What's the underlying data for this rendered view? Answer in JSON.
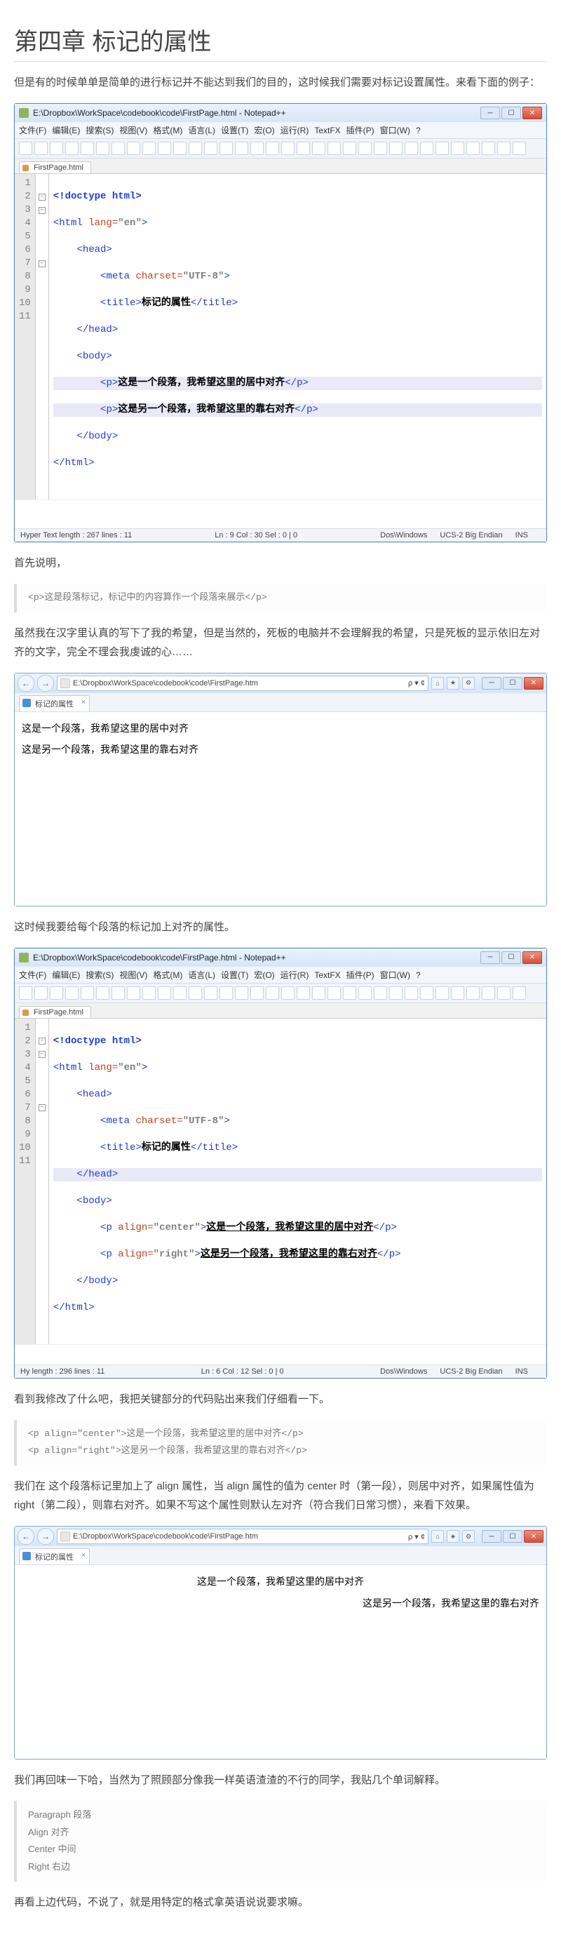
{
  "title": "第四章 标记的属性",
  "intro": "但是有的时候单单是简单的进行标记并不能达到我们的目的，这时候我们需要对标记设置属性。来看下面的例子：",
  "npp1": {
    "title": "E:\\Dropbox\\WorkSpace\\codebook\\code\\FirstPage.html - Notepad++",
    "tab": "FirstPage.html",
    "menus": [
      "文件(F)",
      "编辑(E)",
      "搜索(S)",
      "视图(V)",
      "格式(M)",
      "语言(L)",
      "设置(T)",
      "宏(O)",
      "运行(R)",
      "TextFX",
      "插件(P)",
      "窗口(W)",
      "?"
    ],
    "status": {
      "left": "Hyper Text length : 267     lines : 11",
      "pos": "Ln : 9    Col : 30    Sel : 0 | 0",
      "eol": "Dos\\Windows",
      "enc": "UCS-2 Big Endian",
      "mode": "INS"
    }
  },
  "code1": {
    "l1_a": "<!doctype html>",
    "l2_a": "<",
    "l2_b": "html",
    "l2_c": " lang=",
    "l2_d": "\"en\"",
    "l2_e": ">",
    "l3": "    <head>",
    "l4_a": "        <",
    "l4_b": "meta",
    "l4_c": " charset=",
    "l4_d": "\"UTF-8\"",
    "l4_e": ">",
    "l5_a": "        <",
    "l5_b": "title",
    "l5_c": ">",
    "l5_txt": "标记的属性",
    "l5_d": "</",
    "l5_e": "title",
    "l5_f": ">",
    "l6": "    </head>",
    "l7": "    <body>",
    "l8_a": "        <",
    "l8_b": "p",
    "l8_c": ">",
    "l8_txt": "这是一个段落，我希望这里的居中对齐",
    "l8_d": "</",
    "l8_e": "p",
    "l8_f": ">",
    "l9_a": "        <",
    "l9_b": "p",
    "l9_c": ">",
    "l9_txt": "这是另一个段落，我希望这里的靠右对齐",
    "l9_d": "</",
    "l9_e": "p",
    "l9_f": ">",
    "l10": "    </body>",
    "l11": "</html>"
  },
  "p_first_exp": "首先说明，",
  "bq1": "<p>这是段落标记，标记中的内容算作一个段落来展示</p>",
  "p_wish": "虽然我在汉字里认真的写下了我的希望，但是当然的，死板的电脑并不会理解我的希望，只是死板的显示依旧左对齐的文字，完全不理会我虔诚的心……",
  "ie1": {
    "url": "E:\\Dropbox\\WorkSpace\\codebook\\code\\FirstPage.htm",
    "search_hint": "ρ ▾ ¢",
    "tab": "标记的属性",
    "p1": "这是一个段落，我希望这里的居中对齐",
    "p2": "这是另一个段落，我希望这里的靠右对齐"
  },
  "p_need_attr": "这时候我要给每个段落的标记加上对齐的属性。",
  "npp2": {
    "title": "E:\\Dropbox\\WorkSpace\\codebook\\code\\FirstPage.html - Notepad++",
    "tab": "FirstPage.html",
    "status": {
      "left": "Hy length : 296     lines : 11",
      "pos": "Ln : 6    Col : 12    Sel : 0 | 0",
      "eol": "Dos\\Windows",
      "enc": "UCS-2 Big Endian",
      "mode": "INS"
    }
  },
  "code2": {
    "l8_a": "        <",
    "l8_b": "p",
    "l8_c": " align=",
    "l8_d": "\"center\"",
    "l8_e": ">",
    "l9_txt": "这是一个段落，我希望这里的居中对齐",
    "l10_a": "        <",
    "l10_b": "p",
    "l10_c": " align=",
    "l10_d": "\"right\"",
    "l10_e": ">",
    "l11_txt": "这是另一个段落，我希望这里的靠右对齐"
  },
  "p_see_change": "看到我修改了什么吧，我把关键部分的代码贴出来我们仔细看一下。",
  "bq2_l1": "<p align=\"center\">这是一个段落，我希望这里的居中对齐</p>",
  "bq2_l2": "<p align=\"right\">这是另一个段落，我希望这里的靠右对齐</p>",
  "p_explain": "我们在 这个段落标记里加上了 align 属性，当 align 属性的值为 center 时（第一段），则居中对齐，如果属性值为 right（第二段），则靠右对齐。如果不写这个属性则默认左对齐（符合我们日常习惯），来看下效果。",
  "ie2": {
    "url": "E:\\Dropbox\\WorkSpace\\codebook\\code\\FirstPage.htm",
    "tab": "标记的属性",
    "p1": "这是一个段落，我希望这里的居中对齐",
    "p2": "这是另一个段落，我希望这里的靠右对齐"
  },
  "p_review": "我们再回味一下哈，当然为了照顾部分像我一样英语渣渣的不行的同学，我贴几个单词解释。",
  "voc": {
    "l1": "Paragraph 段落",
    "l2": "Align 对齐",
    "l3": "Center 中间",
    "l4": "Right 右边"
  },
  "p_end": "再看上边代码，不说了，就是用特定的格式拿英语说说要求嘛。"
}
